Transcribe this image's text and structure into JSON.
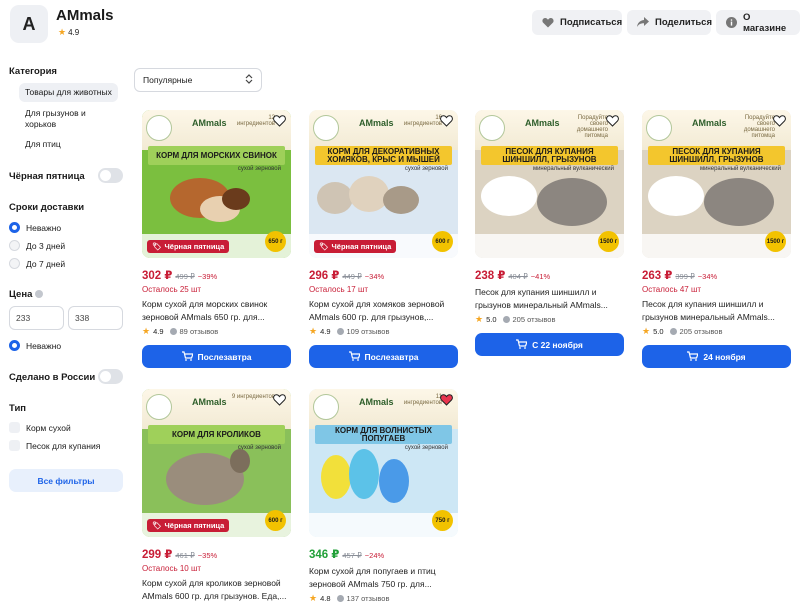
{
  "store": {
    "logo_letter": "A",
    "name": "AMmals",
    "rating": "4.9"
  },
  "header_buttons": {
    "subscribe": "Подписаться",
    "share": "Поделиться",
    "about": "О магазине"
  },
  "sidebar": {
    "category_title": "Категория",
    "categories": [
      "Товары для животных",
      "Для грызунов и",
      "хорьков",
      "Для птиц"
    ],
    "black_friday": "Чёрная пятница",
    "delivery_title": "Сроки доставки",
    "delivery": [
      "Неважно",
      "До 3 дней",
      "До 7 дней"
    ],
    "price_title": "Цена",
    "price_from": "233",
    "price_to": "338",
    "price_any": "Неважно",
    "made_in_russia": "Сделано в России",
    "type_title": "Тип",
    "types": [
      "Корм сухой",
      "Песок для купания"
    ],
    "all_filters": "Все фильтры"
  },
  "sort": {
    "value": "Популярные"
  },
  "promo_label": "Чёрная пятница",
  "products": [
    {
      "img_title": "КОРМ ДЛЯ МОРСКИХ СВИНОК",
      "img_sub": "сухой зерновой",
      "img_note": "12 ингредиентов",
      "gram": "650 г",
      "price": "302 ₽",
      "old": "499 ₽",
      "disc": "−39%",
      "left": "Осталось 25 шт",
      "name": "Корм сухой для морских свинок зерновой AMmals 650 гр. для...",
      "rating": "4.9",
      "reviews": "89 отзывов",
      "button": "Послезавтра",
      "title_bg": "#9fd05a"
    },
    {
      "img_title": "КОРМ ДЛЯ ДЕКОРАТИВНЫХ ХОМЯКОВ, КРЫС И МЫШЕЙ",
      "img_sub": "сухой зерновой",
      "img_note": "16 ингредиентов",
      "gram": "600 г",
      "price": "296 ₽",
      "old": "449 ₽",
      "disc": "−34%",
      "left": "Осталось 17 шт",
      "name": "Корм сухой для хомяков зерновой AMmals 600 гр. для грызунов,...",
      "rating": "4.9",
      "reviews": "109 отзывов",
      "button": "Послезавтра",
      "title_bg": "#f3c62d"
    },
    {
      "img_title": "ПЕСОК ДЛЯ КУПАНИЯ ШИНШИЛЛ, ГРЫЗУНОВ",
      "img_sub": "минеральный вулканический",
      "img_note": "Порадуйте своего домашнего питомца",
      "gram": "1500 г",
      "price": "238 ₽",
      "old": "404 ₽",
      "disc": "−41%",
      "left": "",
      "name": "Песок для купания шиншилл и грызунов минеральный AMmals...",
      "rating": "5.0",
      "reviews": "205 отзывов",
      "button": "С 22 ноября",
      "title_bg": "#f3c62d"
    },
    {
      "img_title": "ПЕСОК ДЛЯ КУПАНИЯ ШИНШИЛЛ, ГРЫЗУНОВ",
      "img_sub": "минеральный вулканический",
      "img_note": "Порадуйте своего домашнего питомца",
      "gram": "1500 г",
      "price": "263 ₽",
      "old": "399 ₽",
      "disc": "−34%",
      "left": "Осталось 47 шт",
      "name": "Песок для купания шиншилл и грызунов минеральный AMmals...",
      "rating": "5.0",
      "reviews": "205 отзывов",
      "button": "24 ноября",
      "title_bg": "#f3c62d"
    },
    {
      "img_title": "КОРМ ДЛЯ КРОЛИКОВ",
      "img_sub": "сухой зерновой",
      "img_note": "9 ингредиентов",
      "gram": "600 г",
      "price": "299 ₽",
      "old": "461 ₽",
      "disc": "−35%",
      "left": "Осталось 10 шт",
      "name": "Корм сухой для кроликов зерновой AMmals 600 гр. для грызунов. Еда,...",
      "rating": "",
      "reviews": "",
      "button": "",
      "title_bg": "#9fd05a"
    },
    {
      "img_title": "КОРМ ДЛЯ ВОЛНИСТЫХ ПОПУГАЕВ",
      "img_sub": "сухой зерновой",
      "img_note": "11 ингредиентов",
      "gram": "750 г",
      "price": "346 ₽",
      "old": "457 ₽",
      "disc": "−24%",
      "left": "",
      "name": "Корм сухой для попугаев и птиц зерновой AMmals 750 гр. для...",
      "rating": "4.8",
      "reviews": "137 отзывов",
      "button": "",
      "title_bg": "#7fc6e6"
    }
  ],
  "colors": {
    "accent": "#1d63e8",
    "price_red": "#c81d36",
    "price_green": "#21a038",
    "star": "#f5a623"
  }
}
